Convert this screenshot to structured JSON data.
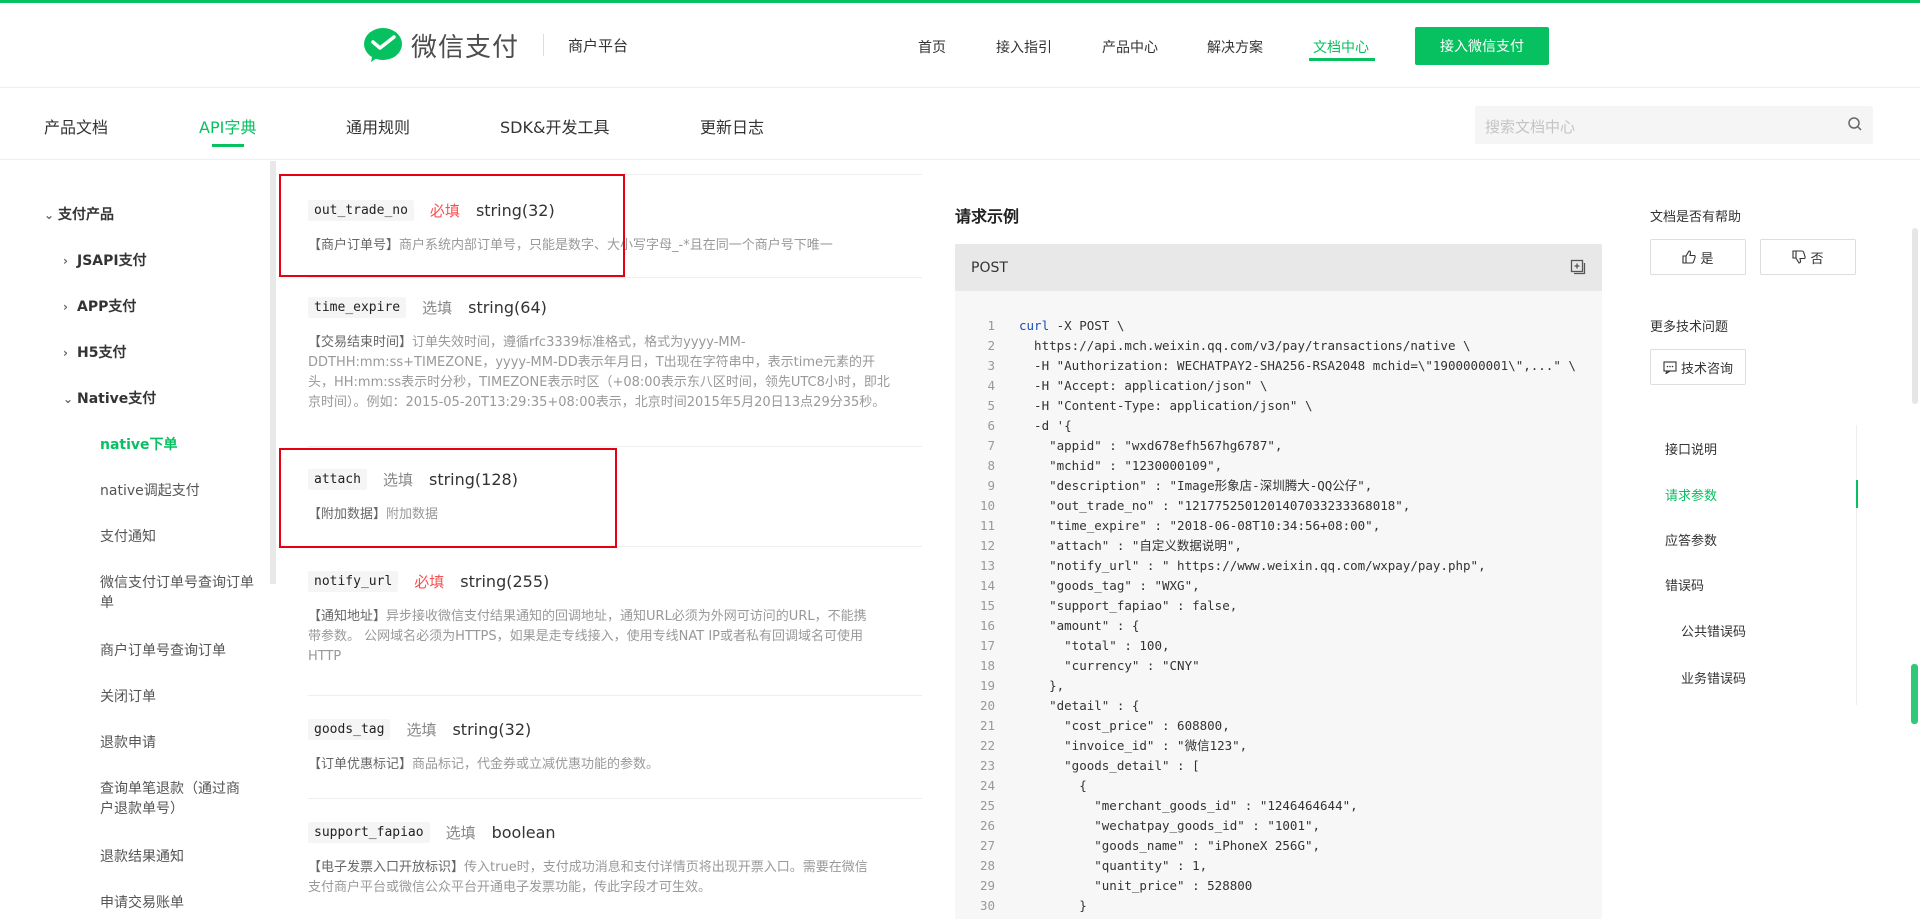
{
  "header": {
    "logo_text": "微信支付",
    "logo_sub": "商户平台",
    "nav": [
      "首页",
      "接入指引",
      "产品中心",
      "解决方案",
      "文档中心"
    ],
    "active_nav": "文档中心",
    "cta_label": "接入微信支付",
    "accent": "#07c160"
  },
  "subnav": {
    "tabs": [
      "产品文档",
      "API字典",
      "通用规则",
      "SDK&开发工具",
      "更新日志"
    ],
    "active_tab": "API字典",
    "search_placeholder": "搜索文档中心"
  },
  "sidebar": {
    "root": "支付产品",
    "groups": [
      "JSAPI支付",
      "APP支付",
      "H5支付",
      "Native支付"
    ],
    "native_items": [
      "native下单",
      "native调起支付",
      "支付通知",
      "微信支付订单号查询订单",
      "单",
      "商户订单号查询订单",
      "关闭订单",
      "退款申请",
      "查询单笔退款（通过商",
      "户退款单号）",
      "退款结果通知",
      "申请交易账单"
    ],
    "active_item": "native下单"
  },
  "params": [
    {
      "name": "out_trade_no",
      "req": "必填",
      "type": "string(32)",
      "label": "【商户订单号】",
      "desc": "商户系统内部订单号，只能是数字、大小写字母_-*且在同一个商户号下唯一"
    },
    {
      "name": "time_expire",
      "req": "选填",
      "type": "string(64)",
      "label": "【交易结束时间】",
      "desc1": "订单失效时间，遵循rfc3339标准格式，格式为yyyy-MM-",
      "desc2": "DDTHH:mm:ss+TIMEZONE，yyyy-MM-DD表示年月日，T出现在字符串中，表示time元素的开",
      "desc3": "头，HH:mm:ss表示时分秒，TIMEZONE表示时区（+08:00表示东八区时间，领先UTC8小时，即北",
      "desc4": "京时间）。例如：2015-05-20T13:29:35+08:00表示，北京时间2015年5月20日13点29分35秒。"
    },
    {
      "name": "attach",
      "req": "选填",
      "type": "string(128)",
      "label": "【附加数据】",
      "desc": "附加数据"
    },
    {
      "name": "notify_url",
      "req": "必填",
      "type": "string(255)",
      "label": "【通知地址】",
      "desc1": "异步接收微信支付结果通知的回调地址，通知URL必须为外网可访问的URL，不能携",
      "desc2": "带参数。 公网域名必须为HTTPS，如果是走专线接入，使用专线NAT IP或者私有回调域名可使用",
      "desc3": "HTTP"
    },
    {
      "name": "goods_tag",
      "req": "选填",
      "type": "string(32)",
      "label": "【订单优惠标记】",
      "desc": "商品标记，代金券或立减优惠功能的参数。"
    },
    {
      "name": "support_fapiao",
      "req": "选填",
      "type": "boolean",
      "label": "【电子发票入口开放标识】",
      "desc1": "传入true时，支付成功消息和支付详情页将出现开票入口。需要在微信",
      "desc2": "支付商户平台或微信公众平台开通电子发票功能，传此字段才可生效。"
    }
  ],
  "code": {
    "title": "请求示例",
    "method": "POST",
    "lines": [
      "curl -X POST \\",
      "  https://api.mch.weixin.qq.com/v3/pay/transactions/native \\",
      "  -H \"Authorization: WECHATPAY2-SHA256-RSA2048 mchid=\\\"1900000001\\\",...\" \\",
      "  -H \"Accept: application/json\" \\",
      "  -H \"Content-Type: application/json\" \\",
      "  -d '{",
      "    \"appid\" : \"wxd678efh567hg6787\",",
      "    \"mchid\" : \"1230000109\",",
      "    \"description\" : \"Image形象店-深圳腾大-QQ公仔\",",
      "    \"out_trade_no\" : \"1217752501201407033233368018\",",
      "    \"time_expire\" : \"2018-06-08T10:34:56+08:00\",",
      "    \"attach\" : \"自定义数据说明\",",
      "    \"notify_url\" : \" https://www.weixin.qq.com/wxpay/pay.php\",",
      "    \"goods_tag\" : \"WXG\",",
      "    \"support_fapiao\" : false,",
      "    \"amount\" : {",
      "      \"total\" : 100,",
      "      \"currency\" : \"CNY\"",
      "    },",
      "    \"detail\" : {",
      "      \"cost_price\" : 608800,",
      "      \"invoice_id\" : \"微信123\",",
      "      \"goods_detail\" : [",
      "        {",
      "          \"merchant_goods_id\" : \"1246464644\",",
      "          \"wechatpay_goods_id\" : \"1001\",",
      "          \"goods_name\" : \"iPhoneX 256G\",",
      "          \"quantity\" : 1,",
      "          \"unit_price\" : 528800",
      "        }"
    ]
  },
  "right": {
    "helpful_title": "文档是否有帮助",
    "yes_label": "是",
    "no_label": "否",
    "more_title": "更多技术问题",
    "consult_label": "技术咨询",
    "toc": [
      "接口说明",
      "请求参数",
      "应答参数",
      "错误码",
      "公共错误码",
      "业务错误码"
    ],
    "toc_active": "请求参数"
  }
}
